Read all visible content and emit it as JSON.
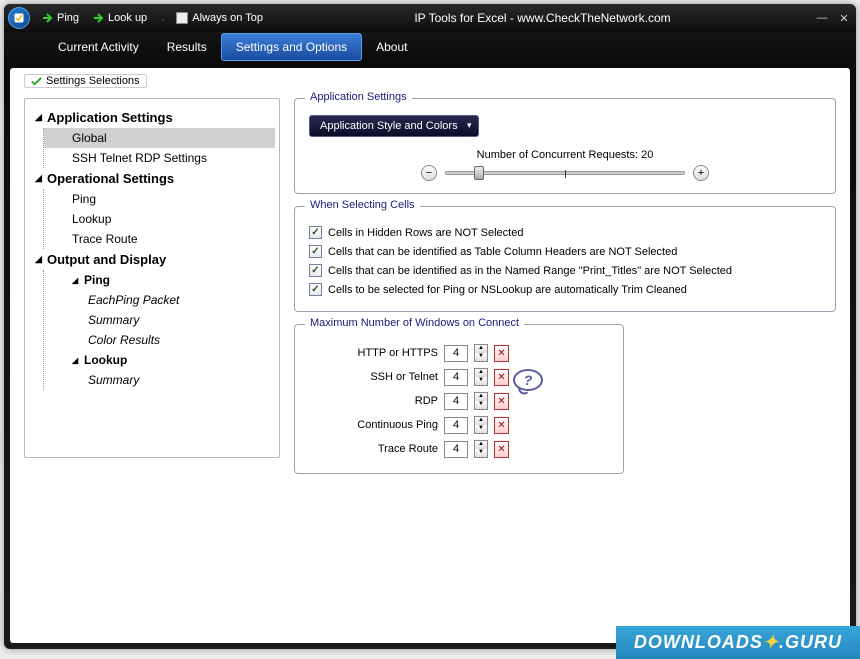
{
  "titlebar": {
    "ping": "Ping",
    "lookup": "Look up",
    "always_on_top": "Always on Top",
    "title": "IP Tools for Excel - www.CheckTheNetwork.com"
  },
  "tabs": {
    "current": "Current Activity",
    "results": "Results",
    "settings": "Settings and Options",
    "about": "About"
  },
  "outer_group": "Settings Selections",
  "tree": {
    "app_settings": "Application Settings",
    "global": "Global",
    "ssh": "SSH  Telnet  RDP Settings",
    "op_settings": "Operational Settings",
    "ping": "Ping",
    "lookup": "Lookup",
    "trace": "Trace Route",
    "output": "Output and Display",
    "out_ping": "Ping",
    "each_packet": "EachPing Packet",
    "summary1": "Summary",
    "color_results": "Color Results",
    "out_lookup": "Lookup",
    "summary2": "Summary"
  },
  "app_group": {
    "title": "Application Settings",
    "dropdown": "Application Style and Colors",
    "slider_label": "Number of Concurrent Requests: 20"
  },
  "cells_group": {
    "title": "When Selecting Cells",
    "c1": "Cells in Hidden Rows are NOT Selected",
    "c2": "Cells that can be identified as Table Column Headers are NOT Selected",
    "c3": "Cells that can be identified as in the Named Range \"Print_Titles\" are NOT Selected",
    "c4": "Cells to be selected for Ping or NSLookup are automatically Trim Cleaned"
  },
  "conn_group": {
    "title": "Maximum Number of Windows on Connect",
    "http": "HTTP or HTTPS",
    "ssh": "SSH or Telnet",
    "rdp": "RDP",
    "ping": "Continuous Ping",
    "trace": "Trace Route",
    "val_http": "4",
    "val_ssh": "4",
    "val_rdp": "4",
    "val_ping": "4",
    "val_trace": "4",
    "help": "?"
  },
  "watermark": {
    "a": "DOWNLOADS",
    "b": ".GURU"
  }
}
